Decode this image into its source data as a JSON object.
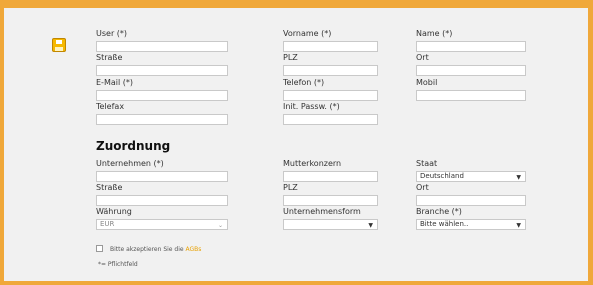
{
  "colors": {
    "frame": "#f0a83a",
    "link": "#e8a000"
  },
  "icons": {
    "save": "save-disk-icon",
    "select": "chevron-down-icon"
  },
  "person": {
    "user_label": "User (*)",
    "vorname_label": "Vorname (*)",
    "name_label": "Name (*)",
    "strasse_label": "Straße",
    "plz_label": "PLZ",
    "ort_label": "Ort",
    "email_label": "E-Mail (*)",
    "telefon_label": "Telefon (*)",
    "mobil_label": "Mobil",
    "telefax_label": "Telefax",
    "passwort_label": "Init. Passw. (*)"
  },
  "zuordnung": {
    "title": "Zuordnung",
    "unternehmen_label": "Unternehmen (*)",
    "mutterkonzern_label": "Mutterkonzern",
    "staat_label": "Staat",
    "staat_value": "Deutschland",
    "strasse_label": "Straße",
    "plz_label": "PLZ",
    "ort_label": "Ort",
    "waehrung_label": "Währung",
    "waehrung_value": "EUR",
    "unternehmensform_label": "Unternehmensform",
    "unternehmensform_value": "",
    "branche_label": "Branche (*)",
    "branche_value": "Bitte wählen.."
  },
  "footer": {
    "agb_prefix": "Bitte akzeptieren Sie die",
    "agb_link": "AGBs",
    "pflicht": "*= Pflichtfeld"
  }
}
